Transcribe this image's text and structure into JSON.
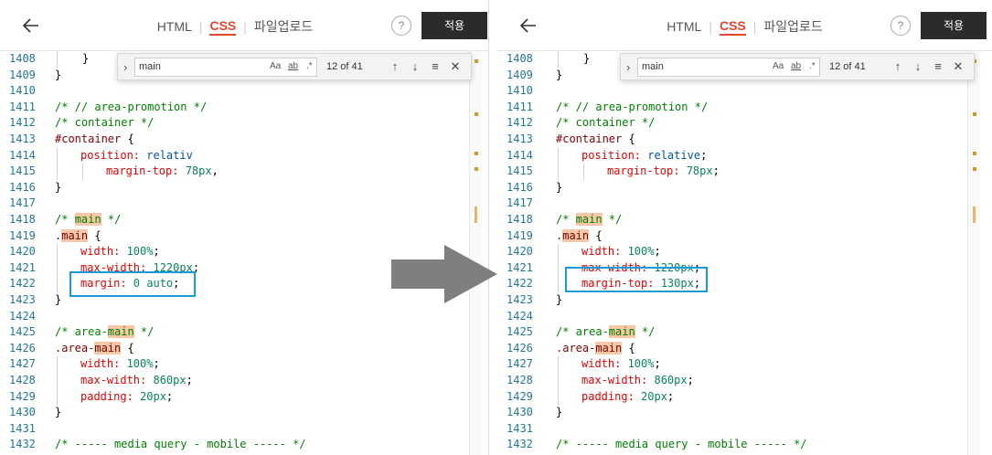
{
  "toolbar": {
    "tab_html": "HTML",
    "tab_css": "CSS",
    "tab_upload": "파일업로드",
    "separator": "|",
    "help": "?",
    "apply": "적용"
  },
  "find": {
    "chevron": "›",
    "query": "main",
    "match_case": "Aa",
    "whole_word": "ab",
    "regex": ".*",
    "count": "12 of 41",
    "prev": "↑",
    "next": "↓",
    "selection": "≡",
    "close": "✕"
  },
  "left": {
    "lines": [
      {
        "n": "1408"
      },
      {
        "n": "1409"
      },
      {
        "n": "1410"
      },
      {
        "n": "1411"
      },
      {
        "n": "1412"
      },
      {
        "n": "1413"
      },
      {
        "n": "1414"
      },
      {
        "n": "1415"
      },
      {
        "n": "1416"
      },
      {
        "n": "1417"
      },
      {
        "n": "1418"
      },
      {
        "n": "1419"
      },
      {
        "n": "1420"
      },
      {
        "n": "1421"
      },
      {
        "n": "1422"
      },
      {
        "n": "1423"
      },
      {
        "n": "1424"
      },
      {
        "n": "1425"
      },
      {
        "n": "1426"
      },
      {
        "n": "1427"
      },
      {
        "n": "1428"
      },
      {
        "n": "1429"
      },
      {
        "n": "1430"
      },
      {
        "n": "1431"
      },
      {
        "n": "1432"
      }
    ],
    "code": {
      "l1408": "}",
      "l1409": "}",
      "l1411": "/* // area-promotion */",
      "l1412": "/* container */",
      "l1413_sel": "#container",
      "l1413_brace": " {",
      "l1414_prop": "position:",
      "l1414_val": " relativ",
      "l1415_prop": "margin-top:",
      "l1415_val": " 78px",
      "l1415_tail": ",",
      "l1416": "}",
      "l1418_a": "/* ",
      "l1418_hl": "main",
      "l1418_b": " */",
      "l1419_dot": ".",
      "l1419_hl": "main",
      "l1419_brace": " {",
      "l1420_prop": "width:",
      "l1420_val": " 100%",
      "l1420_end": ";",
      "l1421_prop": "max-width:",
      "l1421_val": " 1220px",
      "l1421_end": ";",
      "l1422_prop": "margin:",
      "l1422_val": " 0 auto",
      "l1422_end": ";",
      "l1423": "}",
      "l1425_a": "/* area-",
      "l1425_hl": "main",
      "l1425_b": " */",
      "l1426_a": ".area-",
      "l1426_hl": "main",
      "l1426_brace": " {",
      "l1427_prop": "width:",
      "l1427_val": " 100%",
      "l1427_end": ";",
      "l1428_prop": "max-width:",
      "l1428_val": " 860px",
      "l1428_end": ";",
      "l1429_prop": "padding:",
      "l1429_val": " 20px",
      "l1429_end": ";",
      "l1430": "}",
      "l1432": "/* ----- media query - mobile ----- */"
    }
  },
  "right": {
    "code": {
      "l1414_val": " relative",
      "l1414_end": ";",
      "l1415_val": " 78px",
      "l1415_end": ";",
      "l1422_prop": "margin-top:",
      "l1422_val": " 130px",
      "l1422_end": ";"
    }
  },
  "colors": {
    "accent": "#e8432e",
    "highlight_box": "#1a9ad6",
    "line_number": "#237893",
    "comment": "#008000",
    "property": "#e50000",
    "value": "#098658",
    "keyword": "#0451a5",
    "match_highlight": "#f6c8a8",
    "apply_button": "#2b2b2b"
  },
  "icons": {
    "back": "arrow-left-icon",
    "help": "question-circle-icon",
    "transition_arrow": "right-arrow-icon"
  }
}
